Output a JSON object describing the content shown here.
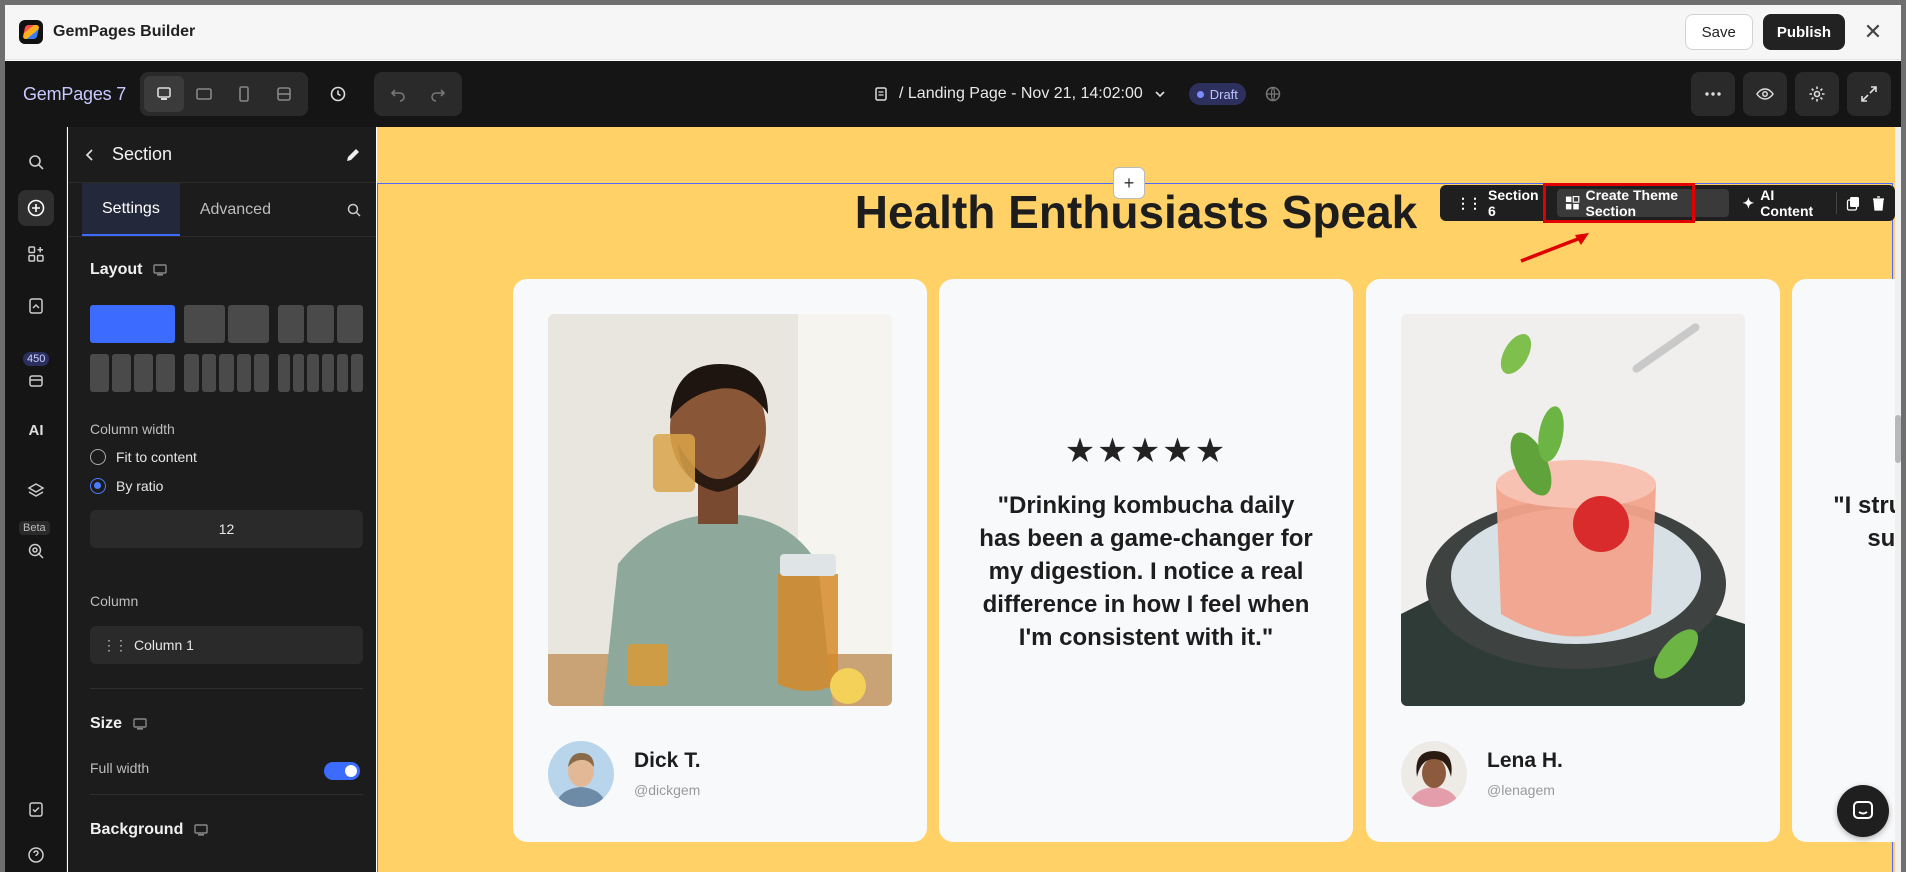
{
  "window": {
    "title": "GemPages Builder",
    "save_label": "Save",
    "publish_label": "Publish",
    "close_glyph": "✕"
  },
  "topbar": {
    "brand": "GemPages 7",
    "page_name": "/ Landing Page - Nov 21, 14:02:00",
    "status": "Draft",
    "devices": [
      "desktop-icon",
      "tablet-landscape-icon",
      "mobile-icon",
      "fit-icon"
    ]
  },
  "rail": {
    "badge_count": "450",
    "beta_label": "Beta"
  },
  "panel": {
    "title": "Section",
    "tabs": [
      "Settings",
      "Advanced"
    ],
    "layout_title": "Layout",
    "column_width_label": "Column width",
    "fit_label": "Fit to content",
    "ratio_label": "By ratio",
    "ratio_value": "12",
    "column_label": "Column",
    "column_item": "Column 1",
    "size_title": "Size",
    "full_width_label": "Full width",
    "background_title": "Background"
  },
  "canvas": {
    "add_glyph": "+",
    "heading": "Health Enthusiasts Speak",
    "toolbar": {
      "section": "Section 6",
      "create_theme": "Create Theme Section",
      "ai": "AI Content"
    },
    "cards": [
      {
        "author": "Dick T.",
        "handle": "@dickgem"
      },
      {
        "stars": "★★★★★",
        "quote": "\"Drinking kombucha daily has been a game-changer for my digestion. I notice a real difference in how I feel when I'm consistent with it.\""
      },
      {
        "author": "Lena H.",
        "handle": "@lenagem"
      },
      {
        "partial_text": "\"I strug lo sust th"
      }
    ]
  },
  "colors": {
    "canvas_bg": "#ffd166",
    "accent": "#3c6bff",
    "highlight": "#e00000"
  }
}
